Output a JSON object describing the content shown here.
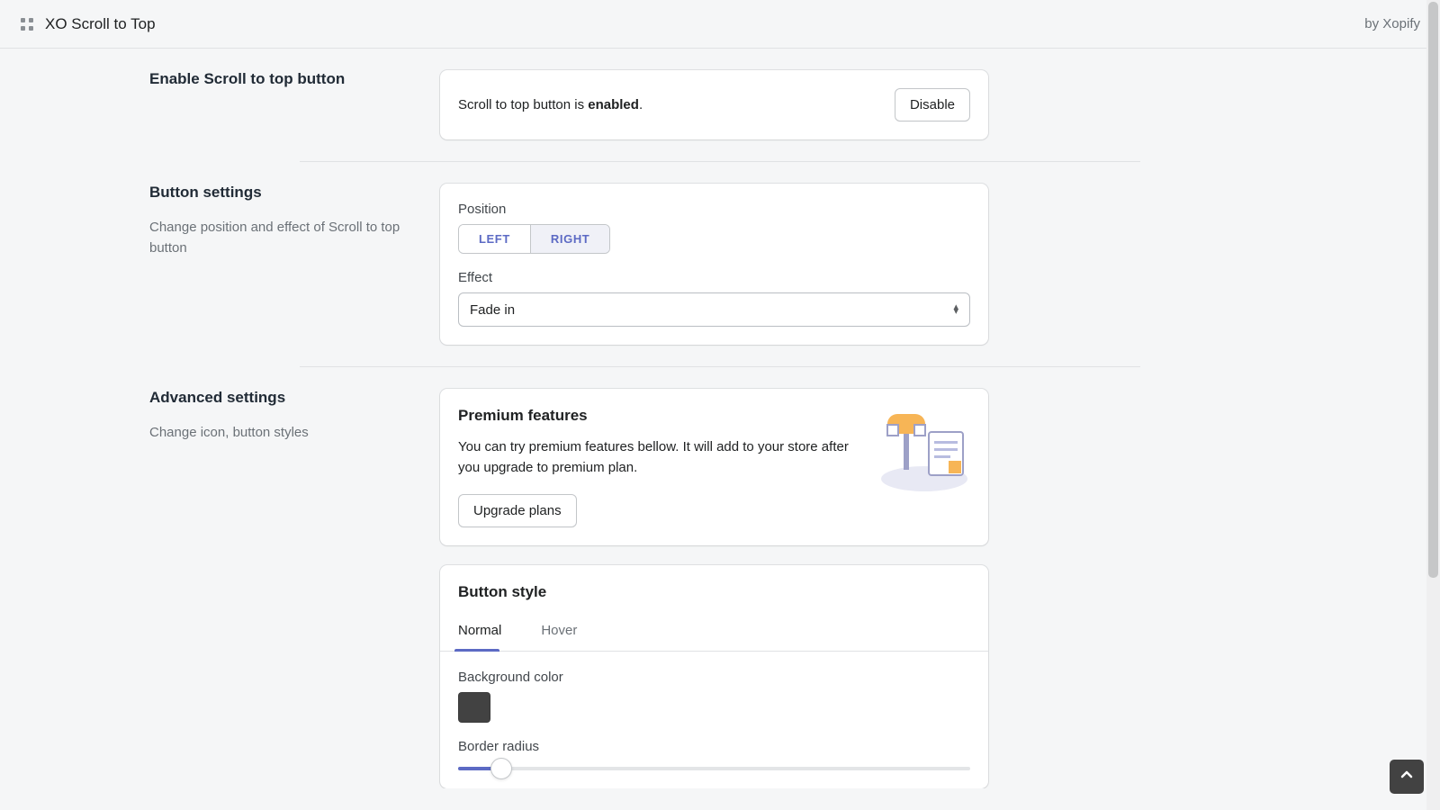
{
  "header": {
    "app_title": "XO Scroll to Top",
    "byline": "by Xopify"
  },
  "enable_section": {
    "title": "Enable Scroll to top button",
    "status_prefix": "Scroll to top button is ",
    "status_value": "enabled",
    "status_suffix": ".",
    "disable_label": "Disable"
  },
  "button_settings": {
    "title": "Button settings",
    "desc": "Change position and effect of Scroll to top button",
    "position_label": "Position",
    "left_label": "LEFT",
    "right_label": "RIGHT",
    "position_value": "right",
    "effect_label": "Effect",
    "effect_value": "Fade in"
  },
  "advanced_settings": {
    "title": "Advanced settings",
    "desc": "Change icon, button styles"
  },
  "premium": {
    "heading": "Premium features",
    "desc": "You can try premium features bellow. It will add to your store after you upgrade to premium plan.",
    "upgrade_label": "Upgrade plans"
  },
  "button_style": {
    "heading": "Button style",
    "tabs": {
      "normal": "Normal",
      "hover": "Hover",
      "active": "normal"
    },
    "bg_label": "Background color",
    "bg_color": "#424242",
    "radius_label": "Border radius",
    "radius_percent": 8.5
  },
  "fab": {
    "bg": "#424242"
  }
}
